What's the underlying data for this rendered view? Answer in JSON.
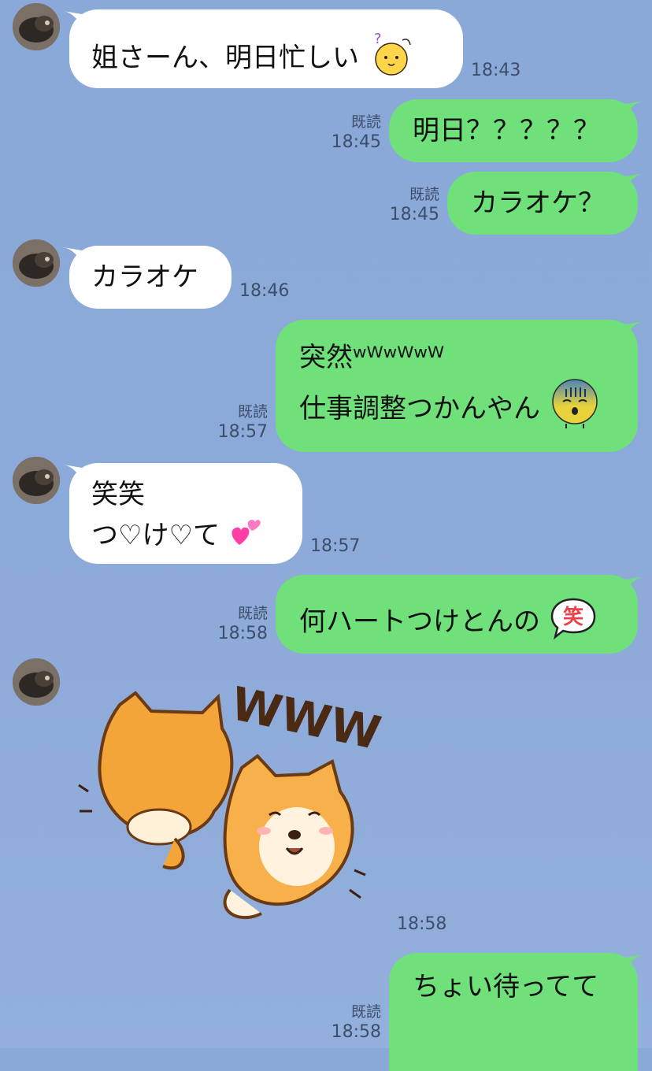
{
  "messages": [
    {
      "text": "姐さーん、明日忙しい",
      "time": "18:43",
      "emoji": "question-face-icon"
    },
    {
      "text": "明日？？？？？",
      "time": "18:45",
      "read": "既読"
    },
    {
      "text": "カラオケ？",
      "time": "18:45",
      "read": "既読"
    },
    {
      "text": "カラオケ",
      "time": "18:46"
    },
    {
      "line1": "突然ʷᵂʷᵂʷᵂ",
      "line1b": "ʷᵂʷᵂʷᵂ",
      "line2": "仕事調整つかんやん",
      "time": "18:57",
      "read": "既読",
      "emoji": "shock-face-icon"
    },
    {
      "line1": "笑笑",
      "line2": "つ♡け♡て",
      "time": "18:57",
      "emoji": "pink-hearts-icon"
    },
    {
      "text": "何ハートつけとんの",
      "time": "18:58",
      "read": "既読",
      "emoji": "laugh-bubble-icon"
    },
    {
      "sticker_text": "WWW",
      "time": "18:58",
      "sticker": "laughing-shiba-cats-sticker"
    },
    {
      "text": "ちょい待ってて",
      "time": "18:58",
      "read": "既読"
    }
  ],
  "colors": {
    "background": "#8aa9d8",
    "incoming": "#ffffff",
    "outgoing": "#6fe07a"
  }
}
